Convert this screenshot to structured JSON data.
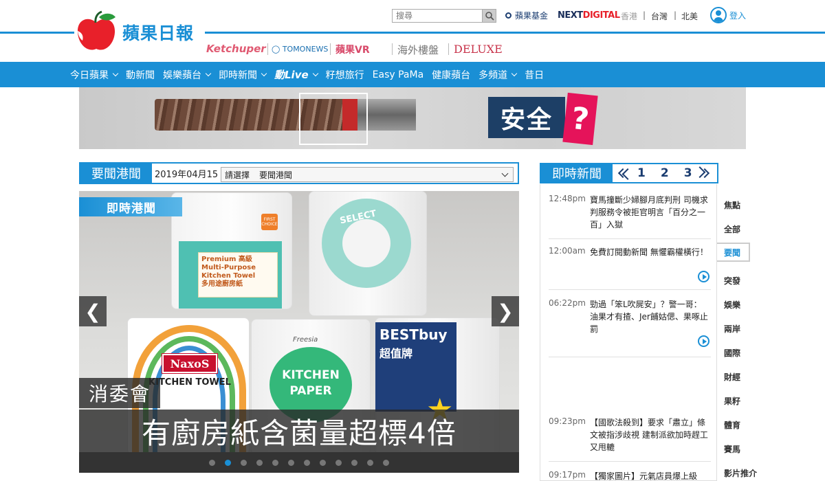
{
  "header": {
    "logo_text": "蘋果日報",
    "search_placeholder": "搜尋",
    "fund_label": "蘋果基金",
    "next_logo_a": "NEXT",
    "next_logo_b": "DIGITAL",
    "regions": [
      "香港",
      "台灣",
      "北美"
    ],
    "region_sep": "|",
    "login_label": "登入",
    "partners": [
      "Ketchuper",
      "TOMONEWS",
      "蘋果VR",
      "海外樓盤",
      "DELUXE"
    ]
  },
  "nav": {
    "items": [
      {
        "label": "今日蘋果",
        "dropdown": true
      },
      {
        "label": "動新聞",
        "dropdown": false
      },
      {
        "label": "娛樂蘋台",
        "dropdown": true
      },
      {
        "label": "即時新聞",
        "dropdown": true
      },
      {
        "label": "動Live",
        "dropdown": true
      },
      {
        "label": "籽想旅行",
        "dropdown": false
      },
      {
        "label": "Easy PaMa",
        "dropdown": false
      },
      {
        "label": "健康蘋台",
        "dropdown": false
      },
      {
        "label": "多頻道",
        "dropdown": true
      },
      {
        "label": "昔日",
        "dropdown": false
      }
    ]
  },
  "banner": {
    "headline": "安全",
    "mark": "?"
  },
  "main": {
    "section_title": "要聞港聞",
    "date": "2019年04月15",
    "select_prompt": "請選擇",
    "select_value": "要聞港聞",
    "hero": {
      "tag": "即時港聞",
      "subtitle": "消委會",
      "title": "有廚房紙含菌量超標4倍",
      "prev_glyph": "❮",
      "next_glyph": "❯",
      "slide_count": 12,
      "active_slide": 2,
      "products": {
        "p1_label": "Premium 高級\nMulti-Purpose\nKitchen Towel\n多用途廚房紙",
        "p1_badge": "FIRST CHOICE",
        "p2_label": "SELECT",
        "p3_brand": "NaxoS",
        "p3_label": "KITCHEN TOWEL",
        "p4_brand": "Freesia",
        "p4_label": "KITCHEN\nPAPER",
        "p5_brand": "BESTbuy",
        "p5_sub": "超值牌",
        "p5_star": "★"
      }
    }
  },
  "realtime": {
    "title": "即時新聞",
    "pages": [
      "1",
      "2",
      "3"
    ],
    "items": [
      {
        "time": "12:48pm",
        "text": "寶馬撞斷少婦腳月底判刑 司機求判服務令被拒官明言「百分之一百」入獄",
        "video": false
      },
      {
        "time": "12:00am",
        "text": "免費訂閱動新聞 無懼霸權橫行！",
        "video": true
      },
      {
        "time": "06:22pm",
        "text": "勁過「笨L吹屍安」？警一哥：油果才有揸、Jer餔姑偲、果啄止罰",
        "video": true
      },
      {
        "time": "09:23pm",
        "text": "【國歌法殺到】要求「肅立」條文被指涉歧視 建制派欲加時趕工又甩轆",
        "video": false
      },
      {
        "time": "09:17pm",
        "text": "【獨家圖片】元氣店員爆上級",
        "video": false
      }
    ],
    "categories": [
      "焦點",
      "全部",
      "要聞",
      "突發",
      "娛樂",
      "兩岸",
      "國際",
      "財經",
      "果籽",
      "體育",
      "賽馬",
      "影片推介"
    ],
    "active_category": "要聞"
  }
}
